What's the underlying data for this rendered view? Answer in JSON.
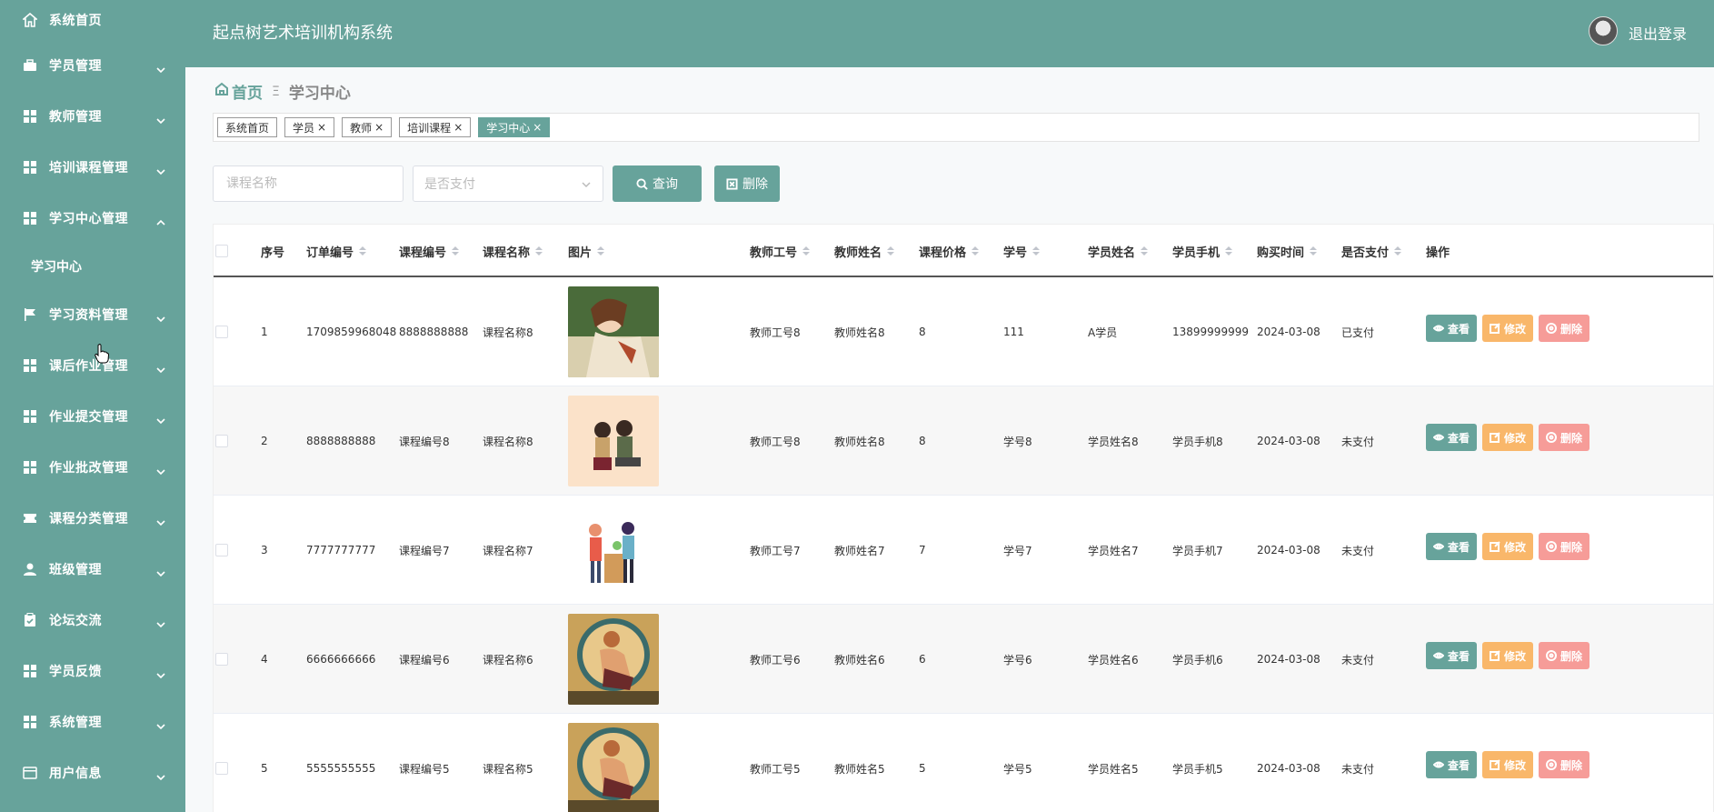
{
  "app": {
    "title": "起点树艺术培训机构系统",
    "logout_label": "退出登录"
  },
  "sidebar": {
    "items": [
      {
        "label": "系统首页",
        "icon": "home-icon",
        "has_arrow": false
      },
      {
        "label": "学员管理",
        "icon": "briefcase-icon",
        "has_arrow": true
      },
      {
        "label": "教师管理",
        "icon": "grid-icon",
        "has_arrow": true
      },
      {
        "label": "培训课程管理",
        "icon": "grid-icon",
        "has_arrow": true
      },
      {
        "label": "学习中心管理",
        "icon": "grid-icon",
        "has_arrow": true,
        "expanded": true,
        "children": [
          "学习中心"
        ]
      },
      {
        "label": "学习资料管理",
        "icon": "flag-icon",
        "has_arrow": true
      },
      {
        "label": "课后作业管理",
        "icon": "grid-icon",
        "has_arrow": true
      },
      {
        "label": "作业提交管理",
        "icon": "grid-icon",
        "has_arrow": true
      },
      {
        "label": "作业批改管理",
        "icon": "grid-icon",
        "has_arrow": true
      },
      {
        "label": "课程分类管理",
        "icon": "ticket-icon",
        "has_arrow": true
      },
      {
        "label": "班级管理",
        "icon": "user-icon",
        "has_arrow": true
      },
      {
        "label": "论坛交流",
        "icon": "clipboard-icon",
        "has_arrow": true
      },
      {
        "label": "学员反馈",
        "icon": "grid-icon",
        "has_arrow": true
      },
      {
        "label": "系统管理",
        "icon": "grid-icon",
        "has_arrow": true
      },
      {
        "label": "用户信息",
        "icon": "id-card-icon",
        "has_arrow": true
      }
    ]
  },
  "breadcrumb": {
    "home": "首页",
    "separator": "Ξ",
    "current": "学习中心"
  },
  "tags": [
    {
      "label": "系统首页",
      "closable": false,
      "active": false
    },
    {
      "label": "学员",
      "closable": true,
      "active": false
    },
    {
      "label": "教师",
      "closable": true,
      "active": false
    },
    {
      "label": "培训课程",
      "closable": true,
      "active": false
    },
    {
      "label": "学习中心",
      "closable": true,
      "active": true
    }
  ],
  "search": {
    "course_name_placeholder": "课程名称",
    "paid_placeholder": "是否支付",
    "query_label": "查询",
    "delete_label": "删除"
  },
  "table": {
    "columns": [
      "序号",
      "订单编号",
      "课程编号",
      "课程名称",
      "图片",
      "教师工号",
      "教师姓名",
      "课程价格",
      "学号",
      "学员姓名",
      "学员手机",
      "购买时间",
      "是否支付",
      "操作"
    ],
    "actions": {
      "view": "查看",
      "edit": "修改",
      "delete": "删除"
    },
    "rows": [
      {
        "index": "1",
        "order_no": "1709859968048",
        "course_no": "8888888888",
        "course_name": "课程名称8",
        "image": "woman-portrait",
        "teacher_id": "教师工号8",
        "teacher_name": "教师姓名8",
        "price": "8",
        "student_no": "111",
        "student_name": "A学员",
        "phone": "13899999999",
        "time": "2024-03-08",
        "paid": "已支付"
      },
      {
        "index": "2",
        "order_no": "8888888888",
        "course_no": "课程编号8",
        "course_name": "课程名称8",
        "image": "couple-illustration",
        "teacher_id": "教师工号8",
        "teacher_name": "教师姓名8",
        "price": "8",
        "student_no": "学号8",
        "student_name": "学员姓名8",
        "phone": "学员手机8",
        "time": "2024-03-08",
        "paid": "未支付"
      },
      {
        "index": "3",
        "order_no": "7777777777",
        "course_no": "课程编号7",
        "course_name": "课程名称7",
        "image": "people-illustration",
        "teacher_id": "教师工号7",
        "teacher_name": "教师姓名7",
        "price": "7",
        "student_no": "学号7",
        "student_name": "学员姓名7",
        "phone": "学员手机7",
        "time": "2024-03-08",
        "paid": "未支付"
      },
      {
        "index": "4",
        "order_no": "6666666666",
        "course_no": "课程编号6",
        "course_name": "课程名称6",
        "image": "art-nouveau-poster",
        "teacher_id": "教师工号6",
        "teacher_name": "教师姓名6",
        "price": "6",
        "student_no": "学号6",
        "student_name": "学员姓名6",
        "phone": "学员手机6",
        "time": "2024-03-08",
        "paid": "未支付"
      },
      {
        "index": "5",
        "order_no": "5555555555",
        "course_no": "课程编号5",
        "course_name": "课程名称5",
        "image": "art-nouveau-poster",
        "teacher_id": "教师工号5",
        "teacher_name": "教师姓名5",
        "price": "5",
        "student_no": "学号5",
        "student_name": "学员姓名5",
        "phone": "学员手机5",
        "time": "2024-03-08",
        "paid": "未支付"
      }
    ]
  },
  "colors": {
    "primary": "#67a39b",
    "edit": "#f9b76a",
    "delete": "#f69c98"
  }
}
